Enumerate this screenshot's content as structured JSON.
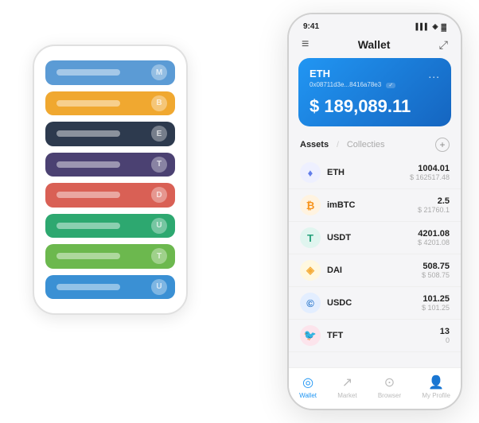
{
  "scene": {
    "back_phone": {
      "cards": [
        {
          "color": "#5b9bd5",
          "dot": "M"
        },
        {
          "color": "#f0a830",
          "dot": "B"
        },
        {
          "color": "#2d3a4e",
          "dot": "E"
        },
        {
          "color": "#4b4172",
          "dot": "T"
        },
        {
          "color": "#d96055",
          "dot": "D"
        },
        {
          "color": "#2da870",
          "dot": "U"
        },
        {
          "color": "#6cb84e",
          "dot": "T"
        },
        {
          "color": "#3a90d4",
          "dot": "U"
        }
      ]
    },
    "front_phone": {
      "status_bar": {
        "time": "9:41",
        "signal": "●●●",
        "wifi": "▲",
        "battery": "▐"
      },
      "header": {
        "menu_icon": "≡",
        "title": "Wallet",
        "expand_icon": "⤢"
      },
      "eth_card": {
        "title": "ETH",
        "address": "0x08711d3e...8416a78e3",
        "checkmark": "✓",
        "more": "...",
        "balance_symbol": "$",
        "balance": "189,089.11"
      },
      "assets_section": {
        "tab_active": "Assets",
        "tab_divider": "/",
        "tab_inactive": "Collecties",
        "add_icon": "+"
      },
      "assets": [
        {
          "icon": "♦",
          "icon_color": "#627eea",
          "icon_bg": "#eef0ff",
          "name": "ETH",
          "amount": "1004.01",
          "usd": "$ 162517.48"
        },
        {
          "icon": "₿",
          "icon_color": "#f7931a",
          "icon_bg": "#fff3e0",
          "name": "imBTC",
          "amount": "2.5",
          "usd": "$ 21760.1"
        },
        {
          "icon": "T",
          "icon_color": "#26a17b",
          "icon_bg": "#e0f5ef",
          "name": "USDT",
          "amount": "4201.08",
          "usd": "$ 4201.08"
        },
        {
          "icon": "◈",
          "icon_color": "#f5ac37",
          "icon_bg": "#fff8e0",
          "name": "DAI",
          "amount": "508.75",
          "usd": "$ 508.75"
        },
        {
          "icon": "©",
          "icon_color": "#2775ca",
          "icon_bg": "#e3eeff",
          "name": "USDC",
          "amount": "101.25",
          "usd": "$ 101.25"
        },
        {
          "icon": "🐦",
          "icon_color": "#e0447c",
          "icon_bg": "#fce4ec",
          "name": "TFT",
          "amount": "13",
          "usd": "0"
        }
      ],
      "bottom_nav": [
        {
          "icon": "◎",
          "label": "Wallet",
          "active": true
        },
        {
          "icon": "↗",
          "label": "Market",
          "active": false
        },
        {
          "icon": "⊙",
          "label": "Browser",
          "active": false
        },
        {
          "icon": "👤",
          "label": "My Profile",
          "active": false
        }
      ]
    }
  }
}
